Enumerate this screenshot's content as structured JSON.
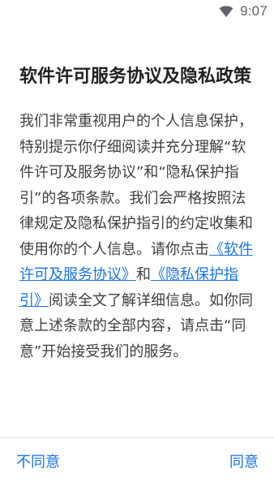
{
  "status_bar": {
    "time": "9:07",
    "wifi_icon": "wifi-icon"
  },
  "dialog": {
    "title": "软件许可服务协议及隐私政策",
    "body_part1": "我们非常重视用户的个人信息保护，特别提示你仔细阅读并充分理解“软件许可及服务协议”和“隐私保护指引”的各项条款。我们会严格按照法律规定及隐私保护指引的约定收集和使用你的个人信息。请你点击",
    "link_service": "《软件许可及服务协议》",
    "body_and": "和",
    "link_privacy": "《隐私保护指引》",
    "body_part2": "阅读全文了解详细信息。如你同意上述条款的全部内容，请点击“同意”开始接受我们的服务。"
  },
  "actions": {
    "disagree_label": "不同意",
    "agree_label": "同意"
  },
  "colors": {
    "accent": "#1a73e8",
    "title": "#202124",
    "body": "#3c4043",
    "divider": "#e0e0e0"
  }
}
